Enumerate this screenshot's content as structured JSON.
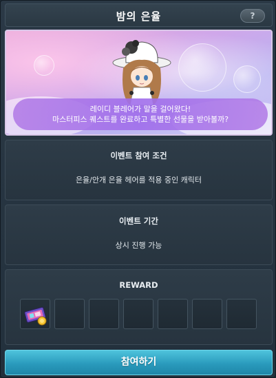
{
  "window": {
    "title": "밤의 은율",
    "help_label": "?"
  },
  "banner": {
    "message_line1": "레이디 블레어가 말을 걸어왔다!",
    "message_line2": "마스터피스 퀘스트를 완료하고 특별한 선물을 받아볼까?"
  },
  "condition": {
    "title": "이벤트 참여 조건",
    "text": "은율/안개 은율 헤어를 적용 중인 캐릭터"
  },
  "period": {
    "title": "이벤트 기간",
    "text": "상시 진행 가능"
  },
  "reward": {
    "title": "REWARD",
    "slots": [
      {
        "icon": "coupon-ticket-icon",
        "filled": true
      },
      {
        "icon": "",
        "filled": false
      },
      {
        "icon": "",
        "filled": false
      },
      {
        "icon": "",
        "filled": false
      },
      {
        "icon": "",
        "filled": false
      },
      {
        "icon": "",
        "filled": false
      },
      {
        "icon": "",
        "filled": false
      }
    ]
  },
  "actions": {
    "join_label": "참여하기"
  },
  "colors": {
    "accent_button": "#2a9bbd",
    "panel_bg": "#2e3c48",
    "banner_bubble": "#b078e6"
  }
}
